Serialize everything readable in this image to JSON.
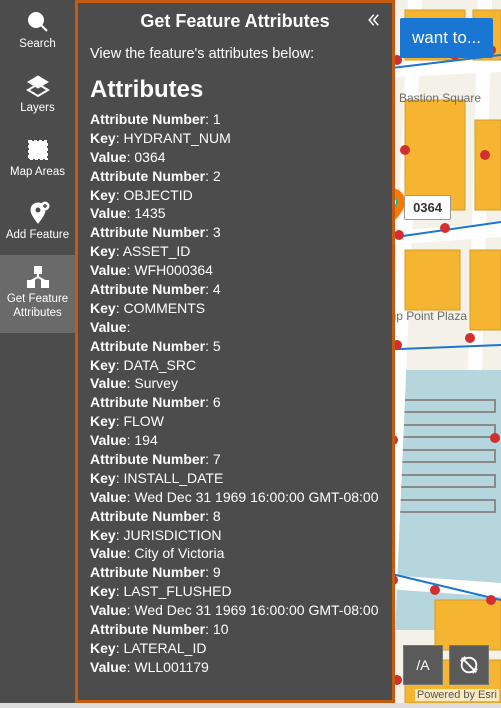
{
  "toolbar": [
    {
      "id": "search",
      "label": "Search",
      "icon": "search"
    },
    {
      "id": "layers",
      "label": "Layers",
      "icon": "layers"
    },
    {
      "id": "mapareas",
      "label": "Map Areas",
      "icon": "mapareas"
    },
    {
      "id": "addfeature",
      "label": "Add Feature",
      "icon": "addfeature"
    },
    {
      "id": "getattrs",
      "label": "Get Feature Attributes",
      "icon": "network",
      "active": true
    }
  ],
  "panel": {
    "title": "Get Feature Attributes",
    "intro": "View the feature's attributes below:",
    "heading": "Attributes",
    "attributes": [
      {
        "n": 1,
        "key": "HYDRANT_NUM",
        "value": "0364"
      },
      {
        "n": 2,
        "key": "OBJECTID",
        "value": "1435"
      },
      {
        "n": 3,
        "key": "ASSET_ID",
        "value": "WFH000364"
      },
      {
        "n": 4,
        "key": "COMMENTS",
        "value": ""
      },
      {
        "n": 5,
        "key": "DATA_SRC",
        "value": "Survey"
      },
      {
        "n": 6,
        "key": "FLOW",
        "value": "194"
      },
      {
        "n": 7,
        "key": "INSTALL_DATE",
        "value": "Wed Dec 31 1969 16:00:00 GMT-08:00"
      },
      {
        "n": 8,
        "key": "JURISDICTION",
        "value": "City of Victoria"
      },
      {
        "n": 9,
        "key": "LAST_FLUSHED",
        "value": "Wed Dec 31 1969 16:00:00 GMT-08:00"
      },
      {
        "n": 10,
        "key": "LATERAL_ID",
        "value": "WLL001179"
      }
    ],
    "labels": {
      "attrnum": "Attribute Number",
      "key": "Key",
      "value": "Value"
    }
  },
  "iwant": "want to...",
  "callout": "0364",
  "map_labels": {
    "ship": "Ship Point\nPlaza",
    "bastion": "Bastion\nSquare"
  },
  "footer": {
    "va": "/A"
  },
  "attribution": "Powered by Esri"
}
